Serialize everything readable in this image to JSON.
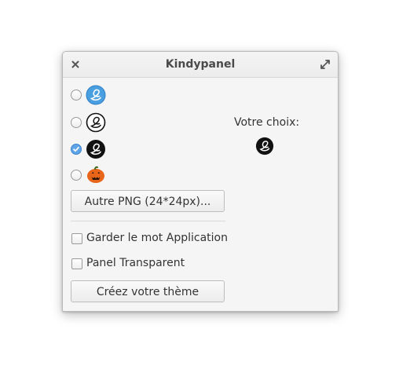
{
  "window": {
    "title": "Kindypanel"
  },
  "logos": [
    {
      "icon": "elementary-logo-blue-icon",
      "selected": false
    },
    {
      "icon": "elementary-logo-outline-icon",
      "selected": false
    },
    {
      "icon": "elementary-logo-black-icon",
      "selected": true
    },
    {
      "icon": "pumpkin-icon",
      "selected": false
    }
  ],
  "choice": {
    "label": "Votre choix:",
    "icon": "elementary-logo-black-icon"
  },
  "buttons": {
    "other_png": "Autre PNG (24*24px)...",
    "create_theme": "Créez votre thème"
  },
  "options": {
    "keep_application_word": "Garder le mot Application",
    "transparent_panel": "Panel Transparent"
  },
  "colors": {
    "accent": "#5fa4e6",
    "logo_blue": "#4a9fe0",
    "pumpkin": "#e8651a"
  }
}
